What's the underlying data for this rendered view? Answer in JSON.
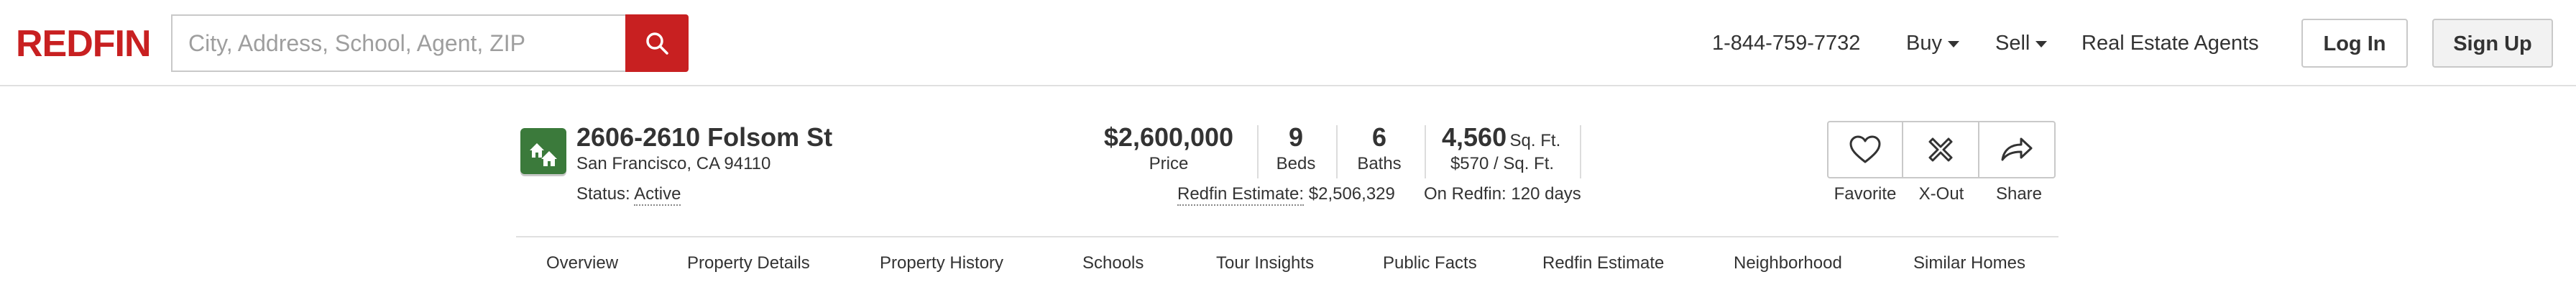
{
  "brand": {
    "logo_text": "REDFIN",
    "accent": "#c82021",
    "badge_green": "#3b7a3b"
  },
  "search": {
    "placeholder": "City, Address, School, Agent, ZIP",
    "value": ""
  },
  "nav": {
    "phone": "1-844-759-7732",
    "buy": "Buy",
    "sell": "Sell",
    "agents": "Real Estate Agents",
    "login": "Log In",
    "signup": "Sign Up"
  },
  "listing": {
    "street": "2606-2610 Folsom St",
    "city": "San Francisco, CA 94110",
    "status_label": "Status:",
    "status_value": "Active",
    "price": "$2,600,000",
    "price_label": "Price",
    "beds": "9",
    "beds_label": "Beds",
    "baths": "6",
    "baths_label": "Baths",
    "sqft": "4,560",
    "sqft_unit": "Sq. Ft.",
    "price_per_sqft": "$570 / Sq. Ft.",
    "estimate_label": "Redfin Estimate:",
    "estimate_value": "$2,506,329",
    "on_redfin": "On Redfin: 120 days"
  },
  "actions": {
    "favorite": "Favorite",
    "xout": "X-Out",
    "share": "Share"
  },
  "tabs": [
    "Overview",
    "Property Details",
    "Property History",
    "Schools",
    "Tour Insights",
    "Public Facts",
    "Redfin Estimate",
    "Neighborhood",
    "Similar Homes"
  ]
}
